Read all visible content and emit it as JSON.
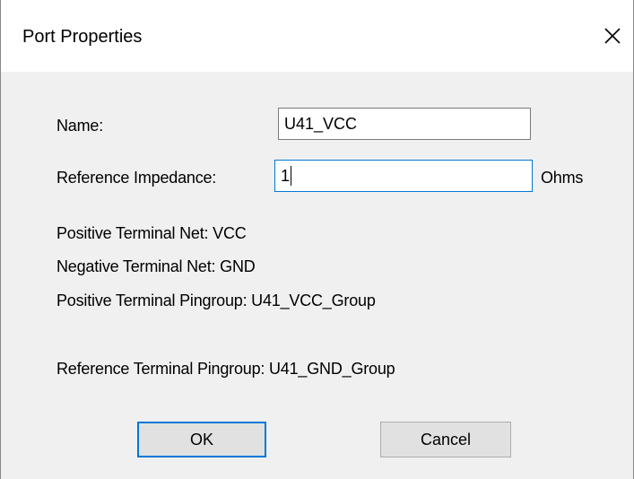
{
  "dialog": {
    "title": "Port Properties",
    "close_label": "close"
  },
  "form": {
    "name_label": "Name:",
    "name_value": "U41_VCC",
    "impedance_label": "Reference Impedance:",
    "impedance_value": "1",
    "impedance_unit": "Ohms"
  },
  "info": {
    "positive_net": "Positive Terminal Net: VCC",
    "negative_net": "Negative Terminal Net: GND",
    "positive_pingroup": "Positive Terminal Pingroup: U41_VCC_Group",
    "reference_pingroup": "Reference Terminal Pingroup: U41_GND_Group"
  },
  "buttons": {
    "ok_label": "OK",
    "cancel_label": "Cancel"
  },
  "colors": {
    "focus_accent": "#0078d7",
    "dialog_background": "#f0f0f0",
    "titlebar_background": "#ffffff"
  }
}
